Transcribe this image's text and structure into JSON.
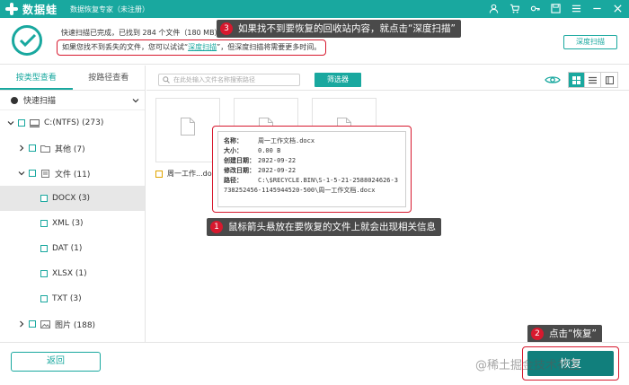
{
  "app": {
    "brand": "数据蛙",
    "subtitle": "数据恢复专家（未注册）"
  },
  "header": {
    "status_line1": "快速扫描已完成，已找到 284 个文件（180 MB）",
    "status_line2_prefix": "如果您找不到丢失的文件，您可以试试“",
    "status_line2_link": "深度扫描",
    "status_line2_suffix": "”，但深度扫描将需要更多时间。",
    "deep_scan_button": "深度扫描"
  },
  "callouts": {
    "c3_num": "3",
    "c3_text": "如果找不到要恢复的回收站内容，就点击“深度扫描”",
    "c1_num": "1",
    "c1_text": "鼠标箭头悬放在要恢复的文件上就会出现相关信息",
    "c2_num": "2",
    "c2_text": "点击“恢复”"
  },
  "sidebar": {
    "tab_type": "按类型查看",
    "tab_path": "按路径查看",
    "scan_mode": "快速扫描",
    "tree": [
      {
        "label": "C:(NTFS) (273)"
      },
      {
        "label": "其他 (7)"
      },
      {
        "label": "文件 (11)"
      },
      {
        "label": "DOCX (3)"
      },
      {
        "label": "XML (3)"
      },
      {
        "label": "DAT (1)"
      },
      {
        "label": "XLSX (1)"
      },
      {
        "label": "TXT (3)"
      },
      {
        "label": "图片 (188)"
      }
    ]
  },
  "toolbar": {
    "search_placeholder": "在此处输入文件名称搜索路径",
    "filter_button": "筛选器"
  },
  "files": {
    "first_label": "周一工作...docx"
  },
  "tooltip": {
    "name_label": "名称：",
    "name_value": "周一工作文档.docx",
    "size_label": "大小：",
    "size_value": "0.00 B",
    "created_label": "创建日期：",
    "created_value": "2022-09-22",
    "modified_label": "修改日期：",
    "modified_value": "2022-09-22",
    "path_label": "路径：",
    "path_value": "C:\\$RECYCLE.BIN\\S-1-5-21-2588024626-3738252456-1145944520-500\\周一工作文档.docx"
  },
  "footer": {
    "back_button": "返回",
    "recover_button": "恢复",
    "watermark": "@稀土掘金技术社区"
  },
  "colors": {
    "accent": "#19a89f",
    "highlight_red": "#d7192e",
    "callout_bg": "#4a4a4a"
  }
}
